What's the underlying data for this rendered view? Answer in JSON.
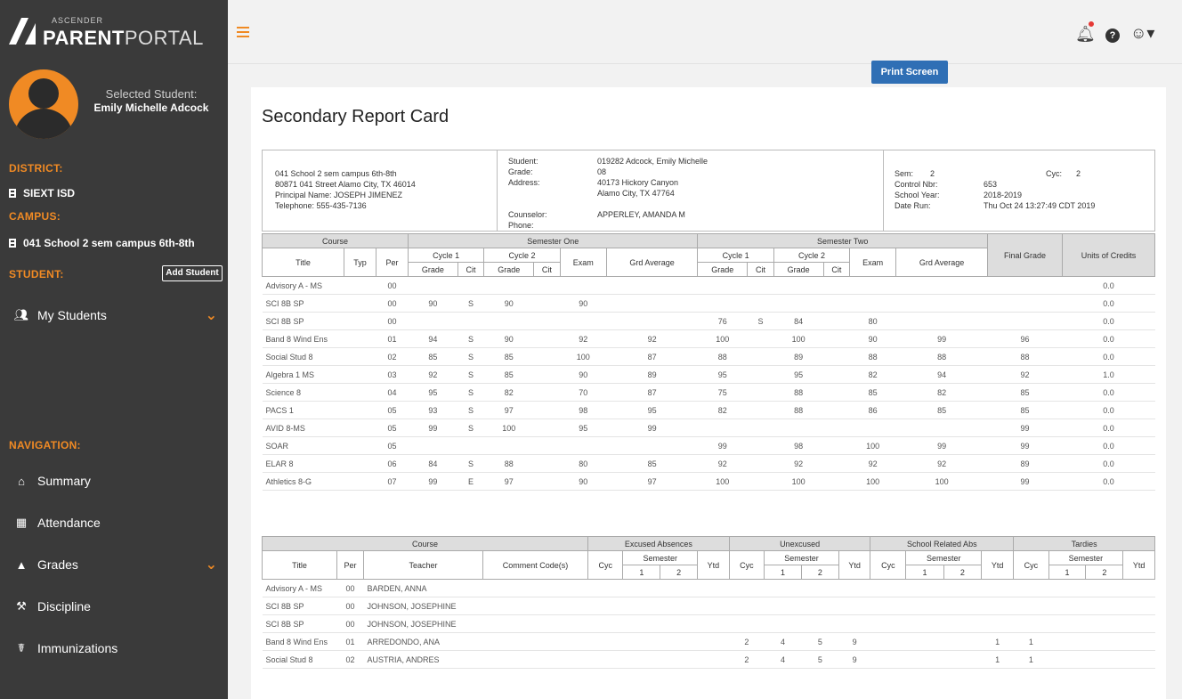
{
  "brand": {
    "small": "ASCENDER",
    "bold": "PARENT",
    "light": "PORTAL"
  },
  "selected_student": {
    "label": "Selected Student:",
    "name": "Emily Michelle Adcock"
  },
  "sidebar": {
    "district_label": "DISTRICT:",
    "district": "SIEXT ISD",
    "campus_label": "CAMPUS:",
    "campus": "041 School 2 sem campus 6th-8th",
    "student_label": "STUDENT:",
    "add_student": "Add Student",
    "my_students": "My Students",
    "navigation_label": "NAVIGATION:",
    "nav": [
      {
        "label": "Summary",
        "icon": "home-icon"
      },
      {
        "label": "Attendance",
        "icon": "calendar-icon"
      },
      {
        "label": "Grades",
        "icon": "graduation-cap-icon"
      },
      {
        "label": "Discipline",
        "icon": "gavel-icon"
      },
      {
        "label": "Immunizations",
        "icon": "medkit-icon"
      }
    ]
  },
  "topbar": {
    "notification_count": "",
    "print_button": "Print Screen"
  },
  "page_title": "Secondary Report Card",
  "header": {
    "school": [
      "041 School 2 sem campus 6th-8th",
      "80871 041 Street Alamo City, TX 46014",
      "Principal Name: JOSEPH JIMENEZ",
      "Telephone: 555-435-7136"
    ],
    "student": [
      {
        "k": "Student:",
        "v": "019282 Adcock, Emily Michelle"
      },
      {
        "k": "Grade:",
        "v": "08"
      },
      {
        "k": "Address:",
        "v": "40173 Hickory Canyon"
      },
      {
        "k": "",
        "v": "Alamo City, TX 47764"
      },
      {
        "k": "Counselor:",
        "v": "APPERLEY, AMANDA M"
      },
      {
        "k": "Phone:",
        "v": ""
      }
    ],
    "meta": [
      {
        "k": "Sem:",
        "v": "2",
        "k2": "Cyc:",
        "v2": "2"
      },
      {
        "k": "Control Nbr:",
        "v": "653"
      },
      {
        "k": "School Year:",
        "v": "2018-2019"
      },
      {
        "k": "Date Run:",
        "v": "Thu Oct 24 13:27:49 CDT 2019"
      }
    ]
  },
  "grades_table": {
    "groups": {
      "course": "Course",
      "sem1": "Semester One",
      "sem2": "Semester Two",
      "final": "Final Grade",
      "credits": "Units of Credits"
    },
    "cols": {
      "title": "Title",
      "typ": "Typ",
      "per": "Per",
      "cycle1": "Cycle 1",
      "cycle2": "Cycle 2",
      "exam": "Exam",
      "grd_avg": "Grd Average",
      "grade": "Grade",
      "cit": "Cit"
    },
    "rows": [
      [
        "Advisory A - MS",
        "",
        "00",
        "",
        "",
        "",
        "",
        "",
        "",
        "",
        "",
        "",
        "",
        "",
        "",
        "",
        "0.0"
      ],
      [
        "SCI 8B SP",
        "",
        "00",
        "90",
        "S",
        "90",
        "",
        "90",
        "",
        "",
        "",
        "",
        "",
        "",
        "",
        "",
        "0.0"
      ],
      [
        "SCI 8B SP",
        "",
        "00",
        "",
        "",
        "",
        "",
        "",
        "",
        "76",
        "S",
        "84",
        "",
        "80",
        "",
        "",
        "0.0"
      ],
      [
        "Band 8 Wind Ens",
        "",
        "01",
        "94",
        "S",
        "90",
        "",
        "92",
        "92",
        "100",
        "",
        "100",
        "",
        "90",
        "99",
        "96",
        "0.0"
      ],
      [
        "Social Stud 8",
        "",
        "02",
        "85",
        "S",
        "85",
        "",
        "100",
        "87",
        "88",
        "",
        "89",
        "",
        "88",
        "88",
        "88",
        "0.0"
      ],
      [
        "Algebra 1 MS",
        "",
        "03",
        "92",
        "S",
        "85",
        "",
        "90",
        "89",
        "95",
        "",
        "95",
        "",
        "82",
        "94",
        "92",
        "1.0"
      ],
      [
        "Science 8",
        "",
        "04",
        "95",
        "S",
        "82",
        "",
        "70",
        "87",
        "75",
        "",
        "88",
        "",
        "85",
        "82",
        "85",
        "0.0"
      ],
      [
        "PACS 1",
        "",
        "05",
        "93",
        "S",
        "97",
        "",
        "98",
        "95",
        "82",
        "",
        "88",
        "",
        "86",
        "85",
        "85",
        "0.0"
      ],
      [
        "AVID 8-MS",
        "",
        "05",
        "99",
        "S",
        "100",
        "",
        "95",
        "99",
        "",
        "",
        "",
        "",
        "",
        "",
        "99",
        "0.0"
      ],
      [
        "SOAR",
        "",
        "05",
        "",
        "",
        "",
        "",
        "",
        "",
        "99",
        "",
        "98",
        "",
        "100",
        "99",
        "99",
        "0.0"
      ],
      [
        "ELAR 8",
        "",
        "06",
        "84",
        "S",
        "88",
        "",
        "80",
        "85",
        "92",
        "",
        "92",
        "",
        "92",
        "92",
        "89",
        "0.0"
      ],
      [
        "Athletics 8-G",
        "",
        "07",
        "99",
        "E",
        "97",
        "",
        "90",
        "97",
        "100",
        "",
        "100",
        "",
        "100",
        "100",
        "99",
        "0.0"
      ]
    ]
  },
  "attendance_table": {
    "groups": {
      "course": "Course",
      "excused": "Excused Absences",
      "unexcused": "Unexcused",
      "school_rel": "School Related Abs",
      "tardies": "Tardies"
    },
    "cols": {
      "title": "Title",
      "per": "Per",
      "teacher": "Teacher",
      "comment": "Comment Code(s)",
      "cyc": "Cyc",
      "semester": "Semester",
      "s1": "1",
      "s2": "2",
      "ytd": "Ytd"
    },
    "rows": [
      [
        "Advisory A - MS",
        "00",
        "BARDEN, ANNA",
        "",
        "",
        "",
        "",
        "",
        "",
        "",
        "",
        "",
        "",
        "",
        "",
        "",
        "",
        "",
        "",
        ""
      ],
      [
        "SCI 8B SP",
        "00",
        "JOHNSON, JOSEPHINE",
        "",
        "",
        "",
        "",
        "",
        "",
        "",
        "",
        "",
        "",
        "",
        "",
        "",
        "",
        "",
        "",
        ""
      ],
      [
        "SCI 8B SP",
        "00",
        "JOHNSON, JOSEPHINE",
        "",
        "",
        "",
        "",
        "",
        "",
        "",
        "",
        "",
        "",
        "",
        "",
        "",
        "",
        "",
        "",
        ""
      ],
      [
        "Band 8 Wind Ens",
        "01",
        "ARREDONDO, ANA",
        "",
        "",
        "",
        "",
        "",
        "2",
        "4",
        "5",
        "9",
        "",
        "",
        "",
        "1",
        "1",
        "",
        "",
        ""
      ],
      [
        "Social Stud 8",
        "02",
        "AUSTRIA, ANDRES",
        "",
        "",
        "",
        "",
        "",
        "2",
        "4",
        "5",
        "9",
        "",
        "",
        "",
        "1",
        "1",
        "",
        "",
        ""
      ]
    ]
  }
}
